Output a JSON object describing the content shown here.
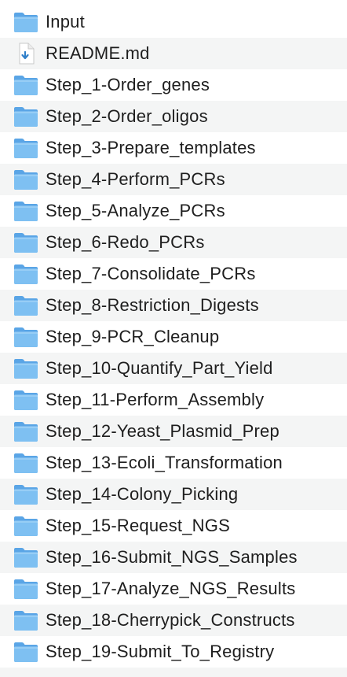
{
  "window_title": "",
  "colors": {
    "row_alt": "#f4f5f5",
    "folder_back": "#5aa5e6",
    "folder_front": "#7ec0f2",
    "doc_arrow": "#2f7fc9"
  },
  "items": [
    {
      "name": "Input",
      "kind": "folder",
      "icon": "folder-icon"
    },
    {
      "name": "README.md",
      "kind": "file",
      "icon": "markdown-file-icon"
    },
    {
      "name": "Step_1-Order_genes",
      "kind": "folder",
      "icon": "folder-icon"
    },
    {
      "name": "Step_2-Order_oligos",
      "kind": "folder",
      "icon": "folder-icon"
    },
    {
      "name": "Step_3-Prepare_templates",
      "kind": "folder",
      "icon": "folder-icon"
    },
    {
      "name": "Step_4-Perform_PCRs",
      "kind": "folder",
      "icon": "folder-icon"
    },
    {
      "name": "Step_5-Analyze_PCRs",
      "kind": "folder",
      "icon": "folder-icon"
    },
    {
      "name": "Step_6-Redo_PCRs",
      "kind": "folder",
      "icon": "folder-icon"
    },
    {
      "name": "Step_7-Consolidate_PCRs",
      "kind": "folder",
      "icon": "folder-icon"
    },
    {
      "name": "Step_8-Restriction_Digests",
      "kind": "folder",
      "icon": "folder-icon"
    },
    {
      "name": "Step_9-PCR_Cleanup",
      "kind": "folder",
      "icon": "folder-icon"
    },
    {
      "name": "Step_10-Quantify_Part_Yield",
      "kind": "folder",
      "icon": "folder-icon"
    },
    {
      "name": "Step_11-Perform_Assembly",
      "kind": "folder",
      "icon": "folder-icon"
    },
    {
      "name": "Step_12-Yeast_Plasmid_Prep",
      "kind": "folder",
      "icon": "folder-icon"
    },
    {
      "name": "Step_13-Ecoli_Transformation",
      "kind": "folder",
      "icon": "folder-icon"
    },
    {
      "name": "Step_14-Colony_Picking",
      "kind": "folder",
      "icon": "folder-icon"
    },
    {
      "name": "Step_15-Request_NGS",
      "kind": "folder",
      "icon": "folder-icon"
    },
    {
      "name": "Step_16-Submit_NGS_Samples",
      "kind": "folder",
      "icon": "folder-icon"
    },
    {
      "name": "Step_17-Analyze_NGS_Results",
      "kind": "folder",
      "icon": "folder-icon"
    },
    {
      "name": "Step_18-Cherrypick_Constructs",
      "kind": "folder",
      "icon": "folder-icon"
    },
    {
      "name": "Step_19-Submit_To_Registry",
      "kind": "folder",
      "icon": "folder-icon"
    }
  ]
}
